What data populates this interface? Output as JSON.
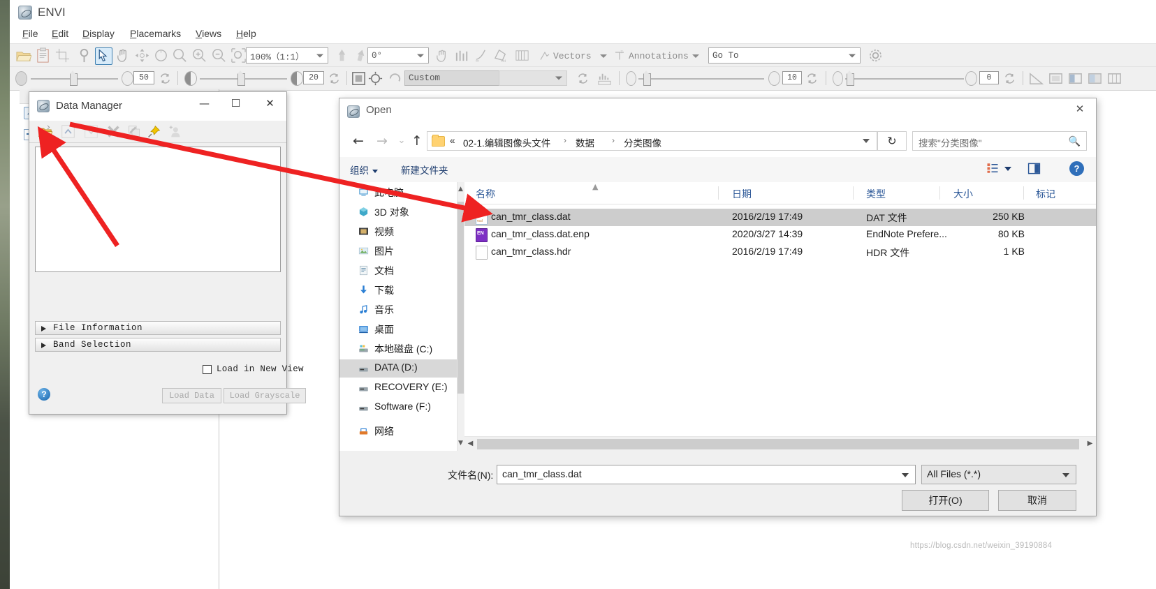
{
  "app": {
    "title": "ENVI",
    "menu": [
      {
        "label": "File",
        "accel": "F"
      },
      {
        "label": "Edit",
        "accel": "E"
      },
      {
        "label": "Display",
        "accel": "D"
      },
      {
        "label": "Placemarks",
        "accel": "P"
      },
      {
        "label": "Views",
        "accel": "V"
      },
      {
        "label": "Help",
        "accel": "H"
      }
    ],
    "toolbar1": {
      "zoom_value": "100%（1:1）",
      "rotation_value": "0°",
      "vectors_label": "Vectors",
      "annotations_label": "Annotations",
      "goto_placeholder": "Go To"
    },
    "toolbar2": {
      "brightness_value": "50",
      "contrast_value": "20",
      "stretch_value": "Custom",
      "sharpen_value": "10",
      "transparency_value": "0"
    }
  },
  "data_manager": {
    "title": "Data Manager",
    "minimize": "—",
    "maximize": "☐",
    "close": "✕",
    "toolbar_icons": [
      "open-file-icon",
      "move-up-icon",
      "move-down-icon",
      "close-file-icon",
      "close-all-icon",
      "pin-icon",
      "metadata-icon"
    ],
    "sections": [
      {
        "label": "File Information"
      },
      {
        "label": "Band Selection"
      }
    ],
    "load_in_new_view_label": "Load in New View",
    "load_in_new_view_checked": false,
    "load_data_label": "Load Data",
    "load_grayscale_label": "Load Grayscale",
    "help_label": "?"
  },
  "open_dialog": {
    "title": "Open",
    "close": "✕",
    "nav": {
      "back": "←",
      "forward": "→",
      "recent": "⌄",
      "up": "↑"
    },
    "breadcrumb": {
      "prefix": "«",
      "items": [
        "02-1.编辑图像头文件",
        "数据",
        "分类图像"
      ],
      "separator": "›"
    },
    "refresh_label": "↻",
    "search_placeholder": "搜索\"分类图像\"",
    "toolbar": {
      "organize_label": "组织",
      "new_folder_label": "新建文件夹",
      "help_label": "?"
    },
    "sidebar": [
      {
        "label": "此电脑",
        "icon": "computer-icon",
        "selected": false
      },
      {
        "label": "3D 对象",
        "icon": "3d-objects-icon",
        "selected": false
      },
      {
        "label": "视频",
        "icon": "videos-icon",
        "selected": false
      },
      {
        "label": "图片",
        "icon": "pictures-icon",
        "selected": false
      },
      {
        "label": "文档",
        "icon": "documents-icon",
        "selected": false
      },
      {
        "label": "下载",
        "icon": "downloads-icon",
        "selected": false
      },
      {
        "label": "音乐",
        "icon": "music-icon",
        "selected": false
      },
      {
        "label": "桌面",
        "icon": "desktop-icon",
        "selected": false
      },
      {
        "label": "本地磁盘 (C:)",
        "icon": "system-drive-icon",
        "selected": false
      },
      {
        "label": "DATA (D:)",
        "icon": "drive-icon",
        "selected": true
      },
      {
        "label": "RECOVERY (E:)",
        "icon": "drive-icon",
        "selected": false
      },
      {
        "label": "Software (F:)",
        "icon": "drive-icon",
        "selected": false
      },
      {
        "label": "网络",
        "icon": "network-icon",
        "selected": false
      }
    ],
    "columns": [
      {
        "label": "名称"
      },
      {
        "label": "日期"
      },
      {
        "label": "类型"
      },
      {
        "label": "大小"
      },
      {
        "label": "标记"
      }
    ],
    "files": [
      {
        "name": "can_tmr_class.dat",
        "date": "2016/2/19 17:49",
        "type": "DAT 文件",
        "size": "250 KB",
        "icon": "dat-file-icon",
        "selected": true
      },
      {
        "name": "can_tmr_class.dat.enp",
        "date": "2020/3/27 14:39",
        "type": "EndNote Prefere...",
        "size": "80 KB",
        "icon": "endnote-file-icon",
        "selected": false
      },
      {
        "name": "can_tmr_class.hdr",
        "date": "2016/2/19 17:49",
        "type": "HDR 文件",
        "size": "1 KB",
        "icon": "generic-file-icon",
        "selected": false
      }
    ],
    "filename_label": "文件名(N):",
    "filename_value": "can_tmr_class.dat",
    "filetype_value": "All Files (*.*)",
    "open_button": "打开(O)",
    "cancel_button": "取消"
  },
  "watermark": "https://blog.csdn.net/weixin_39190884",
  "colors": {
    "accent": "#2b5797",
    "arrow": "#ee2222",
    "selection": "#cdcdcd"
  }
}
